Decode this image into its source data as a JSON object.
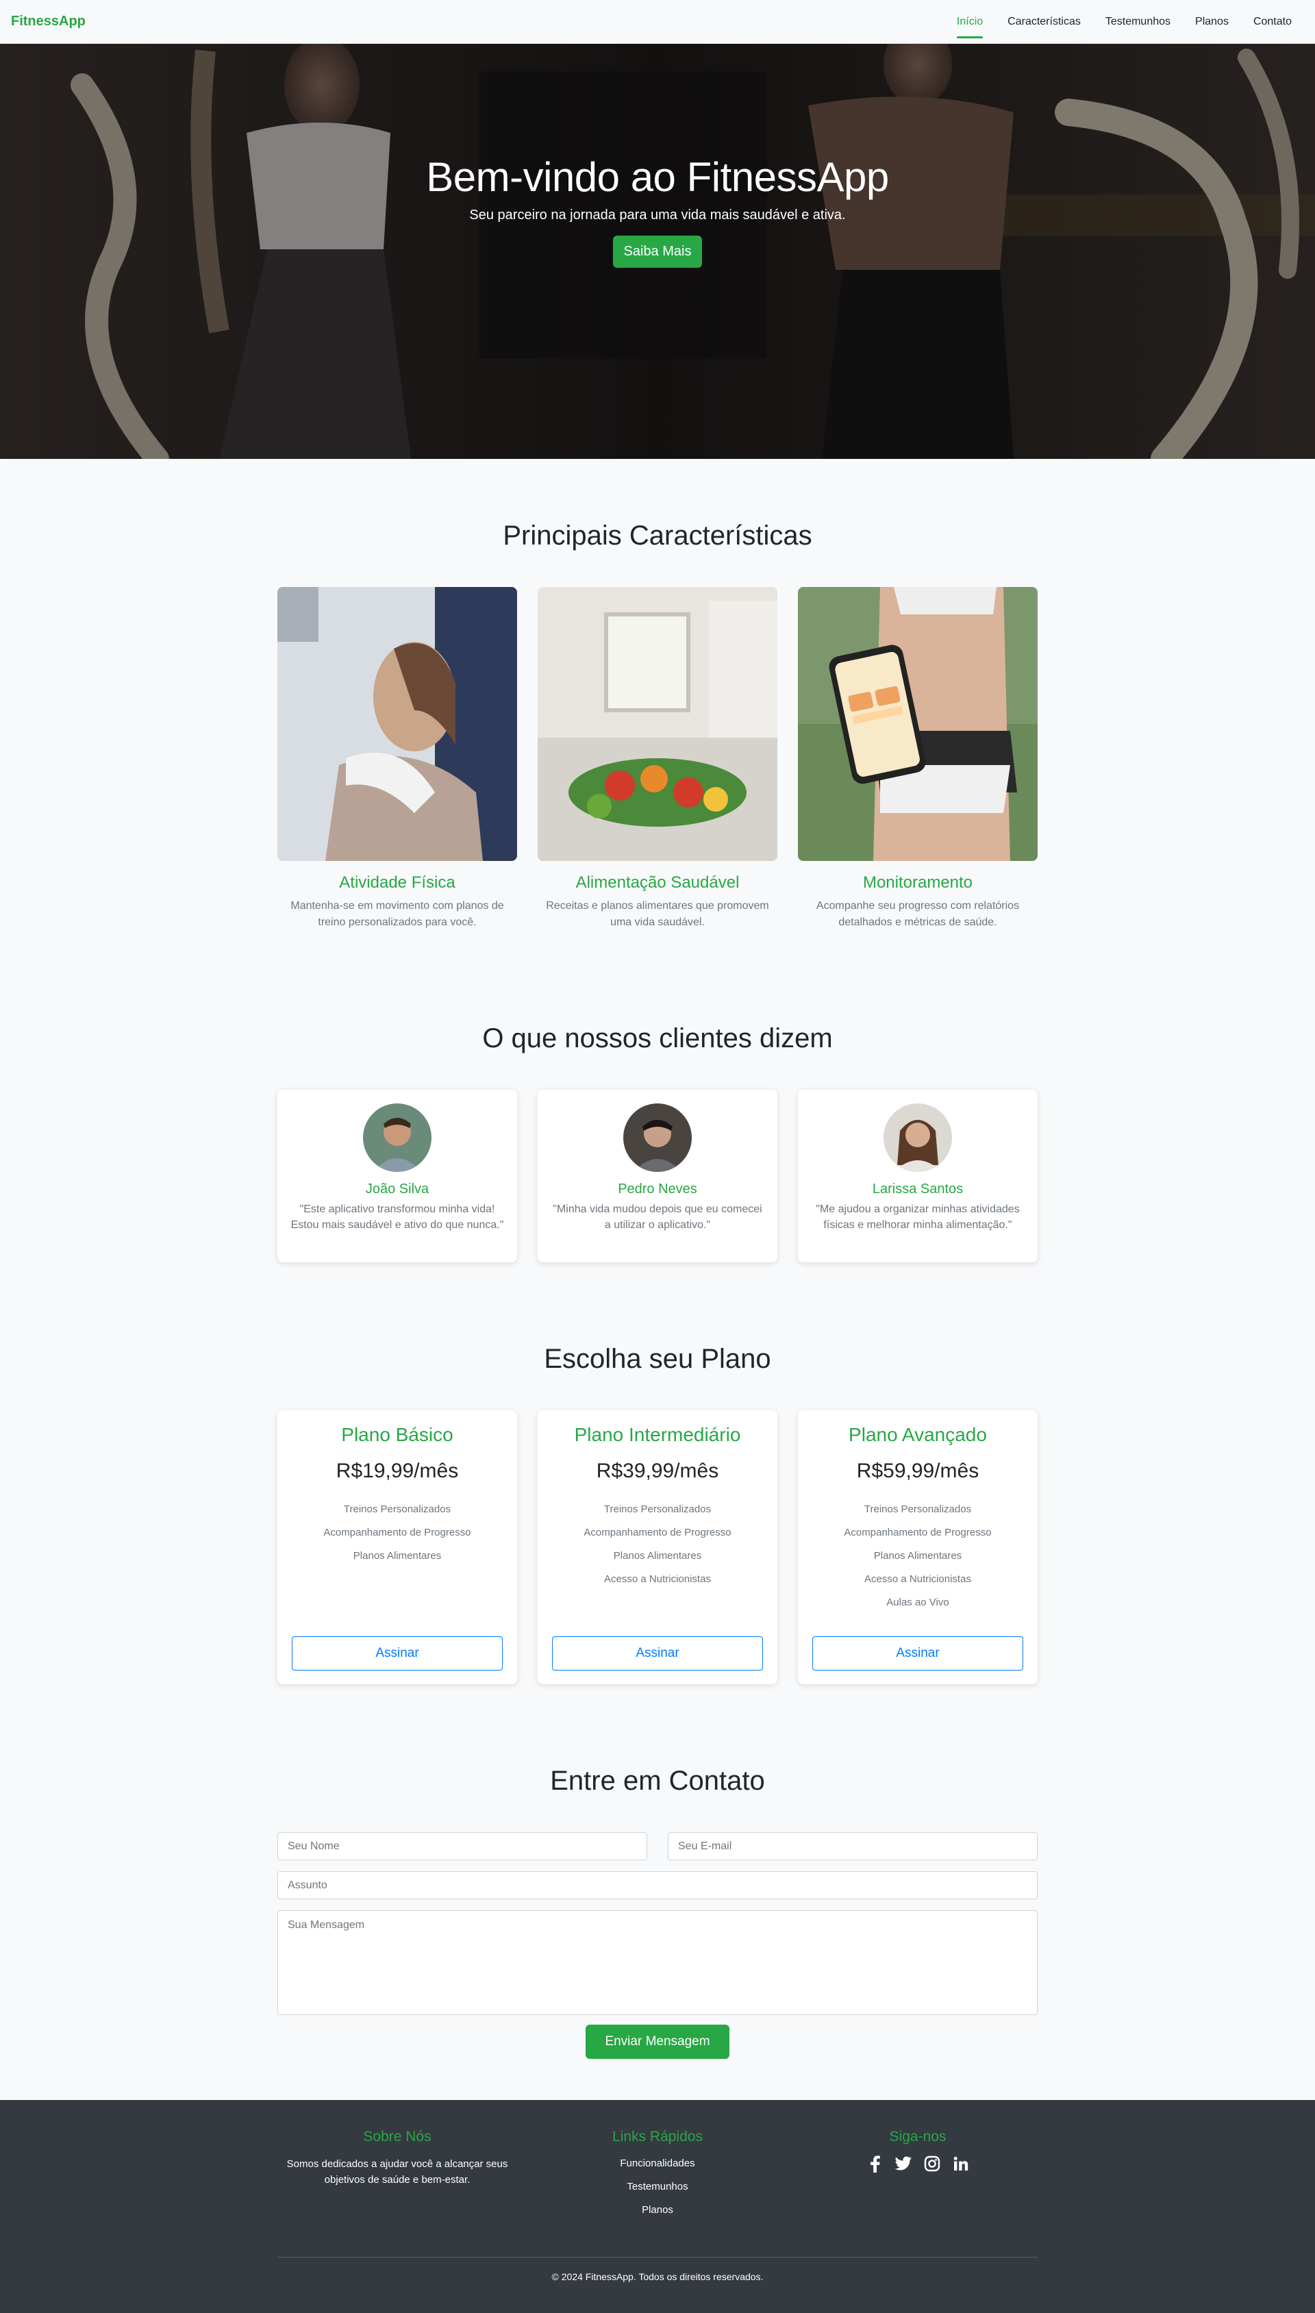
{
  "navbar": {
    "brand": "FitnessApp",
    "links": [
      {
        "label": "Início",
        "active": true
      },
      {
        "label": "Características",
        "active": false
      },
      {
        "label": "Testemunhos",
        "active": false
      },
      {
        "label": "Planos",
        "active": false
      },
      {
        "label": "Contato",
        "active": false
      }
    ]
  },
  "hero": {
    "title": "Bem-vindo ao FitnessApp",
    "subtitle": "Seu parceiro na jornada para uma vida mais saudável e ativa.",
    "button": "Saiba Mais"
  },
  "features": {
    "title": "Principais Características",
    "items": [
      {
        "title": "Atividade Física",
        "text": "Mantenha-se em movimento com planos de treino personalizados para você."
      },
      {
        "title": "Alimentação Saudável",
        "text": "Receitas e planos alimentares que promovem uma vida saudável."
      },
      {
        "title": "Monitoramento",
        "text": "Acompanhe seu progresso com relatórios detalhados e métricas de saúde."
      }
    ]
  },
  "testimonials": {
    "title": "O que nossos clientes dizem",
    "items": [
      {
        "name": "João Silva",
        "text": "\"Este aplicativo transformou minha vida! Estou mais saudável e ativo do que nunca.\""
      },
      {
        "name": "Pedro Neves",
        "text": "\"Minha vida mudou depois que eu comecei a utilizar o aplicativo.\""
      },
      {
        "name": "Larissa Santos",
        "text": "\"Me ajudou a organizar minhas atividades físicas e melhorar minha alimentação.\""
      }
    ]
  },
  "plans": {
    "title": "Escolha seu Plano",
    "items": [
      {
        "name": "Plano Básico",
        "price": "R$19,99/mês",
        "features": [
          "Treinos Personalizados",
          "Acompanhamento de Progresso",
          "Planos Alimentares"
        ],
        "button": "Assinar"
      },
      {
        "name": "Plano Intermediário",
        "price": "R$39,99/mês",
        "features": [
          "Treinos Personalizados",
          "Acompanhamento de Progresso",
          "Planos Alimentares",
          "Acesso a Nutricionistas"
        ],
        "button": "Assinar"
      },
      {
        "name": "Plano Avançado",
        "price": "R$59,99/mês",
        "features": [
          "Treinos Personalizados",
          "Acompanhamento de Progresso",
          "Planos Alimentares",
          "Acesso a Nutricionistas",
          "Aulas ao Vivo"
        ],
        "button": "Assinar"
      }
    ]
  },
  "contact": {
    "title": "Entre em Contato",
    "name_placeholder": "Seu Nome",
    "email_placeholder": "Seu E-mail",
    "subject_placeholder": "Assunto",
    "message_placeholder": "Sua Mensagem",
    "button": "Enviar Mensagem"
  },
  "footer": {
    "about_title": "Sobre Nós",
    "about_text": "Somos dedicados a ajudar você a alcançar seus objetivos de saúde e bem-estar.",
    "links_title": "Links Rápidos",
    "links": [
      "Funcionalidades",
      "Testemunhos",
      "Planos"
    ],
    "social_title": "Siga-nos",
    "social_icons": [
      "facebook-icon",
      "twitter-icon",
      "instagram-icon",
      "linkedin-icon"
    ],
    "copyright": "© 2024 FitnessApp. Todos os direitos reservados."
  },
  "colors": {
    "accent": "#28a745",
    "plan_button": "#007bff",
    "footer_bg": "#343a40"
  }
}
